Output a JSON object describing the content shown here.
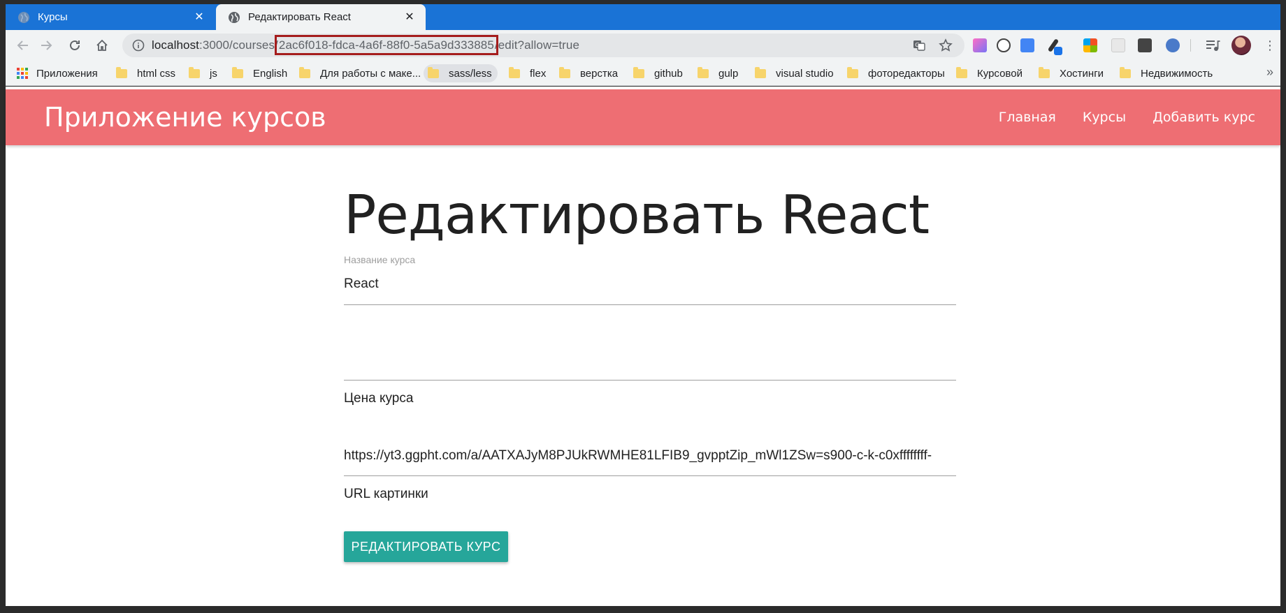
{
  "browser": {
    "tabs": [
      {
        "label": "Курсы",
        "active": false
      },
      {
        "label": "Редактировать React",
        "active": true
      }
    ],
    "url": {
      "host": "localhost",
      "before": ":3000/courses/",
      "highlighted": "2ac6f018-fdca-4a6f-88f0-5a5a9d333885",
      "after": "/edit?allow=true"
    },
    "bookmarks": [
      {
        "label": "Приложения",
        "type": "apps"
      },
      {
        "label": "html css",
        "type": "folder"
      },
      {
        "label": "js",
        "type": "folder"
      },
      {
        "label": "English",
        "type": "folder"
      },
      {
        "label": "Для работы с маке...",
        "type": "folder"
      },
      {
        "label": "sass/less",
        "type": "folder",
        "selected": true
      },
      {
        "label": "flex",
        "type": "folder"
      },
      {
        "label": "верстка",
        "type": "folder"
      },
      {
        "label": "github",
        "type": "folder"
      },
      {
        "label": "gulp",
        "type": "folder"
      },
      {
        "label": "visual studio",
        "type": "folder"
      },
      {
        "label": "фоторедакторы",
        "type": "folder"
      },
      {
        "label": "Курсовой",
        "type": "folder"
      },
      {
        "label": "Хостинги",
        "type": "folder"
      },
      {
        "label": "Недвижимость",
        "type": "folder"
      }
    ],
    "more_bookmarks": "»"
  },
  "app": {
    "brand": "Приложение курсов",
    "nav": [
      "Главная",
      "Курсы",
      "Добавить курс"
    ],
    "accent_color": "#ee6e73",
    "button_color": "#26a69a"
  },
  "form": {
    "title": "Редактировать React",
    "name_label": "Название курса",
    "name_value": "React",
    "price_label": "Цена курса",
    "price_value": "",
    "img_value": "https://yt3.ggpht.com/a/AATXAJyM8PJUkRWMHE81LFIB9_gvpptZip_mWl1ZSw=s900-c-k-c0xffffffff-",
    "img_label": "URL картинки",
    "submit_label": "Редактировать курс"
  }
}
